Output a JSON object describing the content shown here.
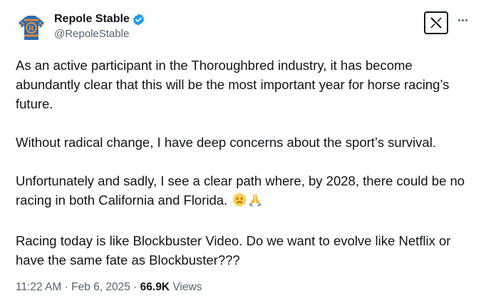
{
  "author": {
    "display_name": "Repole Stable",
    "handle": "@RepoleStable",
    "verified": true,
    "avatar_icon": "jockey-silks-icon",
    "avatar_letter": "R"
  },
  "actions": {
    "platform_icon": "x-logo-icon",
    "more_icon": "more-options-icon"
  },
  "tweet": {
    "paragraphs": [
      "As an active participant in the Thoroughbred industry, it has become abundantly clear that this will be the most important year for horse racing’s future.",
      "Without radical change, I have deep concerns about the sport’s survival.",
      "Unfortunately and sadly, I see a clear path where, by 2028, there could be no racing in both California and Florida.",
      "Racing today is like Blockbuster Video. Do we want to evolve like Netflix or have the same fate as Blockbuster???"
    ],
    "emojis": [
      "crying-face-icon",
      "folded-hands-icon"
    ]
  },
  "meta": {
    "time": "11:22 AM",
    "separator": " · ",
    "date": "Feb 6, 2025",
    "views_count": "66.9K",
    "views_label": " Views"
  },
  "colors": {
    "text": "#0f1419",
    "secondary": "#536471",
    "verified_blue": "#1d9bf0",
    "silks_blue": "#2b6cb0",
    "silks_orange": "#f08c2e"
  }
}
